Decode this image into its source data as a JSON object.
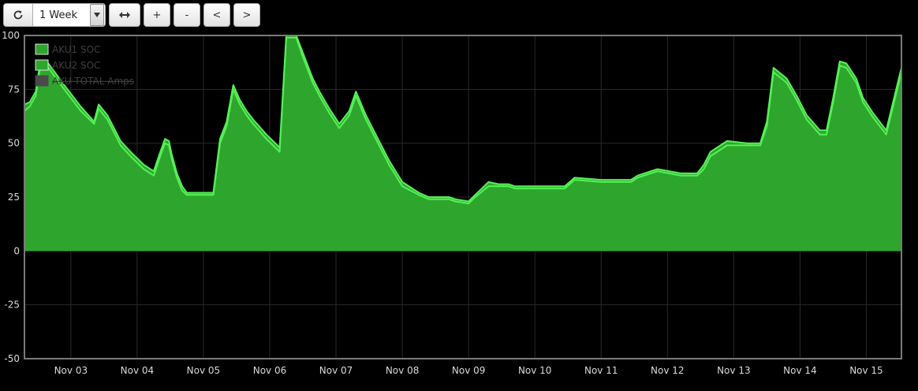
{
  "toolbar": {
    "refresh_icon": "refresh-icon",
    "range_value": "1 Week",
    "fit_icon": "expand-horizontal-icon",
    "zoom_in_label": "+",
    "zoom_out_label": "-",
    "prev_label": "<",
    "next_label": ">"
  },
  "colors": {
    "background": "#000000",
    "fill": "#2ea62e",
    "line": "#55f055",
    "grid": "#2a2a2a",
    "frame": "#7a7a7a",
    "disabled_legend": "#4a4a4a"
  },
  "chart_data": {
    "type": "area",
    "title": "",
    "xlabel": "",
    "ylabel": "",
    "ylim": [
      -50,
      100
    ],
    "yticks": [
      100,
      75,
      50,
      25,
      0,
      -25,
      -50
    ],
    "xlim": [
      2.3,
      15.53
    ],
    "xticks": [
      {
        "x": 3,
        "label": "Nov 03"
      },
      {
        "x": 4,
        "label": "Nov 04"
      },
      {
        "x": 5,
        "label": "Nov 05"
      },
      {
        "x": 6,
        "label": "Nov 06"
      },
      {
        "x": 7,
        "label": "Nov 07"
      },
      {
        "x": 8,
        "label": "Nov 08"
      },
      {
        "x": 9,
        "label": "Nov 09"
      },
      {
        "x": 10,
        "label": "Nov 10"
      },
      {
        "x": 11,
        "label": "Nov 11"
      },
      {
        "x": 12,
        "label": "Nov 12"
      },
      {
        "x": 13,
        "label": "Nov 13"
      },
      {
        "x": 14,
        "label": "Nov 14"
      },
      {
        "x": 15,
        "label": "Nov 15"
      }
    ],
    "x_unit": "day of November",
    "grid": true,
    "legend_position": "top-left",
    "series": [
      {
        "name": "AKU1 SOC",
        "enabled": true,
        "x": [
          2.3,
          2.38,
          2.47,
          2.54,
          2.66,
          2.9,
          3.15,
          3.35,
          3.42,
          3.55,
          3.65,
          3.75,
          3.9,
          4.1,
          4.25,
          4.35,
          4.42,
          4.48,
          4.52,
          4.6,
          4.68,
          4.75,
          4.9,
          4.95,
          5.15,
          5.25,
          5.35,
          5.45,
          5.55,
          5.65,
          5.75,
          5.95,
          6.15,
          6.25,
          6.4,
          6.5,
          6.65,
          6.75,
          6.9,
          7.05,
          7.2,
          7.3,
          7.45,
          7.55,
          7.65,
          7.8,
          8.0,
          8.25,
          8.4,
          8.55,
          8.7,
          8.8,
          9.0,
          9.1,
          9.3,
          9.45,
          9.6,
          9.7,
          10.0,
          10.3,
          10.45,
          10.6,
          11.0,
          11.3,
          11.45,
          11.55,
          11.85,
          12.2,
          12.35,
          12.45,
          12.55,
          12.65,
          12.9,
          13.2,
          13.3,
          13.4,
          13.5,
          13.6,
          13.8,
          13.95,
          14.1,
          14.3,
          14.4,
          14.5,
          14.6,
          14.7,
          14.85,
          14.95,
          15.1,
          15.2,
          15.3,
          15.53
        ],
        "y": [
          68,
          69,
          74,
          88,
          87,
          77,
          67,
          60,
          68,
          63,
          57,
          51,
          46,
          40,
          37,
          46,
          52,
          51,
          45,
          36,
          30,
          27,
          27,
          27,
          27,
          52,
          60,
          77,
          70,
          65,
          61,
          54,
          48,
          100,
          100,
          92,
          80,
          74,
          66,
          59,
          65,
          74,
          63,
          57,
          51,
          42,
          32,
          27,
          25,
          25,
          25,
          24,
          23,
          26,
          32,
          31,
          31,
          30,
          30,
          30,
          30,
          34,
          33,
          33,
          33,
          35,
          38,
          36,
          36,
          36,
          40,
          46,
          51,
          50,
          50,
          50,
          60,
          85,
          80,
          72,
          63,
          56,
          56,
          71,
          88,
          87,
          80,
          71,
          64,
          60,
          56,
          85
        ]
      },
      {
        "name": "AKU2 SOC",
        "enabled": true,
        "x": [
          2.3,
          2.38,
          2.47,
          2.54,
          2.66,
          2.9,
          3.15,
          3.35,
          3.42,
          3.55,
          3.65,
          3.75,
          3.9,
          4.1,
          4.25,
          4.35,
          4.42,
          4.48,
          4.52,
          4.6,
          4.68,
          4.75,
          4.9,
          4.95,
          5.15,
          5.25,
          5.35,
          5.45,
          5.55,
          5.65,
          5.75,
          5.95,
          6.15,
          6.25,
          6.4,
          6.5,
          6.65,
          6.75,
          6.9,
          7.05,
          7.2,
          7.3,
          7.45,
          7.55,
          7.65,
          7.8,
          8.0,
          8.25,
          8.4,
          8.55,
          8.7,
          8.8,
          9.0,
          9.1,
          9.3,
          9.45,
          9.6,
          9.7,
          10.0,
          10.3,
          10.45,
          10.6,
          11.0,
          11.3,
          11.45,
          11.55,
          11.85,
          12.2,
          12.35,
          12.45,
          12.55,
          12.65,
          12.9,
          13.2,
          13.3,
          13.4,
          13.5,
          13.6,
          13.8,
          13.95,
          14.1,
          14.3,
          14.4,
          14.5,
          14.6,
          14.7,
          14.85,
          14.95,
          15.1,
          15.2,
          15.3,
          15.53
        ],
        "y": [
          65,
          67,
          72,
          86,
          85,
          75,
          65,
          59,
          66,
          61,
          55,
          49,
          44,
          38,
          35,
          44,
          50,
          49,
          43,
          34,
          28,
          26,
          26,
          26,
          26,
          50,
          58,
          75,
          68,
          63,
          59,
          52,
          46,
          99,
          99,
          90,
          78,
          72,
          64,
          57,
          63,
          72,
          61,
          55,
          49,
          40,
          30,
          26,
          24,
          24,
          24,
          23,
          22,
          25,
          30,
          30,
          30,
          29,
          29,
          29,
          29,
          33,
          32,
          32,
          32,
          34,
          37,
          35,
          35,
          35,
          38,
          44,
          49,
          49,
          49,
          49,
          58,
          83,
          78,
          70,
          61,
          54,
          54,
          69,
          86,
          85,
          78,
          69,
          62,
          58,
          54,
          83
        ]
      },
      {
        "name": "AKU TOTAL Amps",
        "enabled": false,
        "x": [],
        "y": []
      }
    ]
  }
}
